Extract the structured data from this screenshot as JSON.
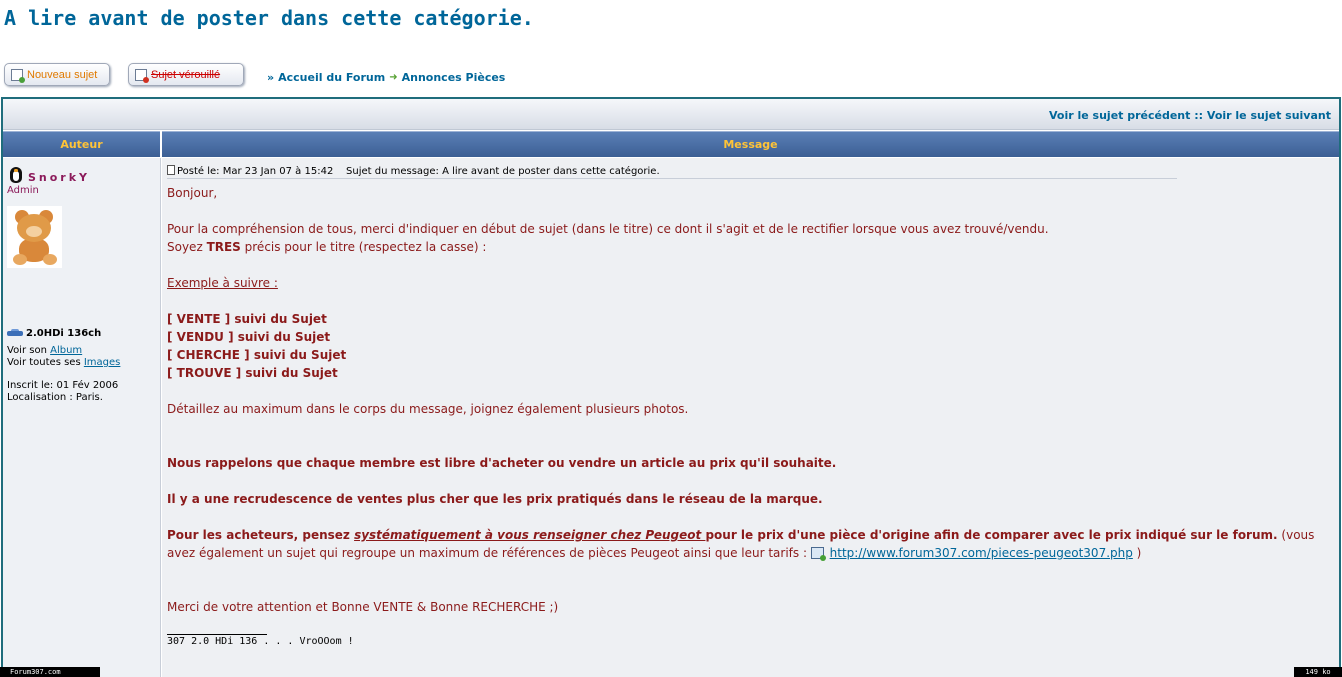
{
  "page": {
    "title": "A lire avant de poster dans cette catégorie."
  },
  "toolbar": {
    "new_topic_label": "Nouveau sujet",
    "locked_topic_label": "Sujet vérouillé"
  },
  "breadcrumb": {
    "prefix": "»",
    "forum_home": "Accueil du Forum",
    "category": "Annonces Pièces"
  },
  "topic_nav": {
    "previous": "Voir le sujet précédent",
    "separator": "::",
    "next": "Voir le sujet suivant"
  },
  "table_headers": {
    "author": "Auteur",
    "message": "Message"
  },
  "author": {
    "name": "SnorkY",
    "rank": "Admin",
    "car": "2.0HDi 136ch",
    "album_prefix": "Voir son",
    "album_link": "Album",
    "images_prefix": "Voir toutes ses",
    "images_link": "Images",
    "joined": "Inscrit le: 01 Fév 2006",
    "location": "Localisation : Paris."
  },
  "post": {
    "posted_on": "Posté le: Mar 23 Jan 07 à 15:42",
    "subject": "Sujet du message: A lire avant de poster dans cette catégorie.",
    "greeting": "Bonjour,",
    "intro1": "Pour la compréhension de tous, merci d'indiquer en début de sujet (dans le titre) ce dont il s'agit et de le rectifier lorsque vous avez trouvé/vendu.",
    "intro2_pre": "Soyez ",
    "intro2_bold": "TRES",
    "intro2_post": " précis pour le titre (respectez la casse) :",
    "example_heading": "Exemple à suivre :",
    "examples": [
      "[ VENTE ] suivi du Sujet",
      "[ VENDU ] suivi du Sujet",
      "[ CHERCHE ] suivi du Sujet",
      "[ TROUVE ] suivi du Sujet"
    ],
    "details": "Détaillez au maximum dans le corps du message, joignez également plusieurs photos.",
    "reminder1": "Nous rappelons que chaque membre est libre d'acheter ou vendre un article au prix qu'il souhaite.",
    "reminder2": "Il y a une recrudescence de ventes plus cher que les prix pratiqués dans le réseau de la marque.",
    "buyers_pre": "Pour les acheteurs, pensez ",
    "buyers_emph": "systématiquement à vous renseigner chez Peugeot ",
    "buyers_post": "pour le prix d'une pièce d'origine afin de comparer avec le prix indiqué sur le forum.",
    "buyers_note": " (vous avez également un sujet qui regroupe un maximum de références de pièces Peugeot ainsi que leur tarifs : ",
    "link": "http://www.forum307.com/pieces-peugeot307.php",
    "buyers_close": " )",
    "closing": "Merci de votre attention et Bonne VENTE & Bonne RECHERCHE ;)",
    "signature": "307 2.0 HDi 136 . . . VroOOom !"
  },
  "status": {
    "left": "Forum307.com",
    "right": "149 ko"
  }
}
